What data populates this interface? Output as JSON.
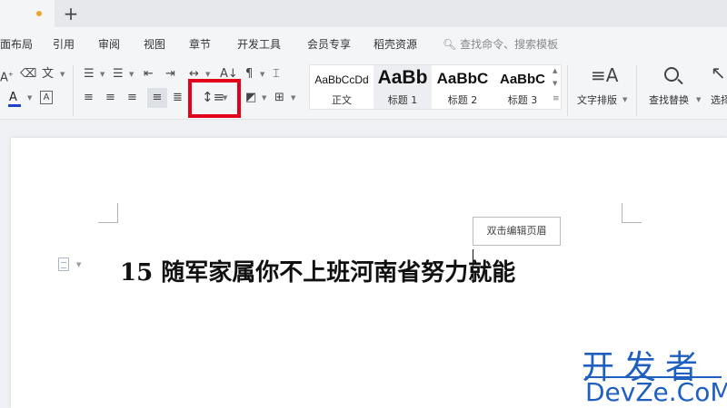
{
  "menu": {
    "items": [
      {
        "label": "面布局"
      },
      {
        "label": "引用"
      },
      {
        "label": "审阅"
      },
      {
        "label": "视图"
      },
      {
        "label": "章节"
      },
      {
        "label": "开发工具"
      },
      {
        "label": "会员专享"
      },
      {
        "label": "稻壳资源"
      }
    ],
    "search_label": "查找命令、搜索模板"
  },
  "styles": {
    "items": [
      {
        "sample": "AaBbCcDd",
        "name": "正文"
      },
      {
        "sample": "AaBb",
        "name": "标题 1"
      },
      {
        "sample": "AaBbC",
        "name": "标题 2"
      },
      {
        "sample": "AaBbC",
        "name": "标题 3"
      }
    ]
  },
  "ribbon": {
    "text_layout_label": "文字排版",
    "find_replace_label": "查找替换",
    "select_label": "选择"
  },
  "document": {
    "header_hint": "双击编辑页眉",
    "body_text": "15 随军家属你不上班河南省努力就能"
  },
  "watermark": {
    "cn": "开发者",
    "en": "DevZe.CoM"
  },
  "colors": {
    "highlight": "#e3001b",
    "accent": "#1f5fbf",
    "font_color_underline": "#2040c8",
    "tab_dot": "#f0a030"
  }
}
